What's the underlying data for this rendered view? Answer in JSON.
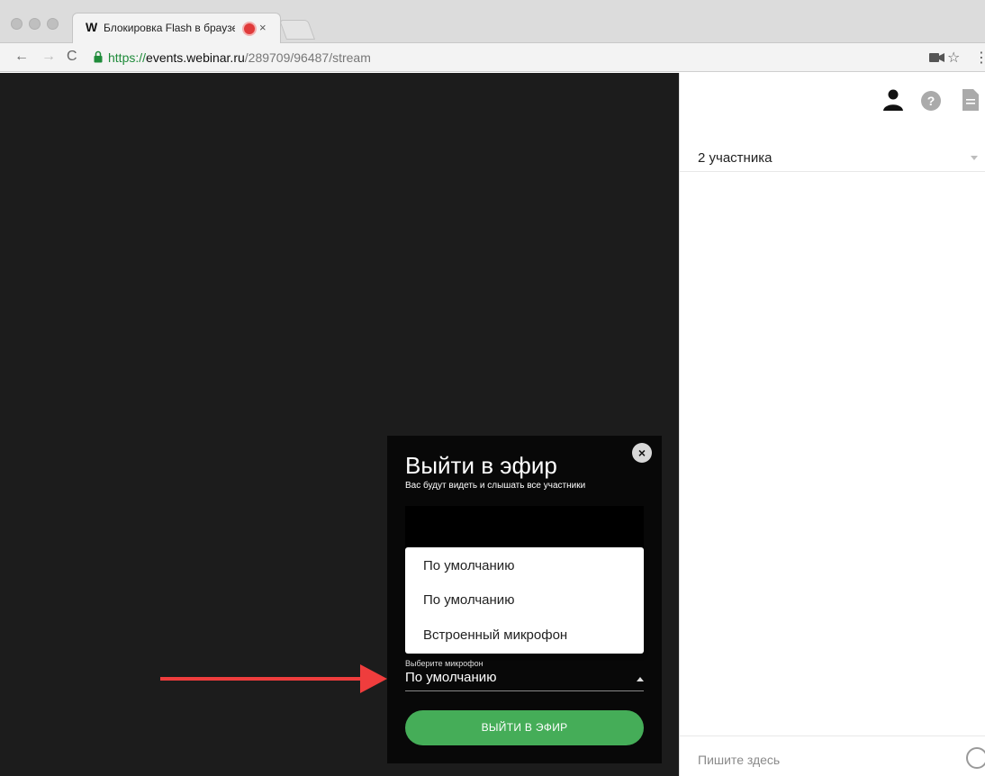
{
  "browser": {
    "tab_logo": "W",
    "tab_title": "Блокировка Flash в браузе",
    "tab_close": "×",
    "url_protocol": "https://",
    "url_host": "events.webinar.ru",
    "url_path": "/289709/96487/stream",
    "star": "☆",
    "menu": "⋮"
  },
  "sidebar": {
    "participants": "2 участника",
    "chat_placeholder": "Пишите здесь"
  },
  "modal": {
    "title": "Выйти в эфир",
    "subtitle": "Вас будут видеть и слышать все участники",
    "close": "×",
    "dropdown_options": [
      "По умолчанию",
      "По умолчанию",
      "Встроенный микрофон"
    ],
    "mic_label": "Выберите микрофон",
    "mic_value": "По умолчанию",
    "go_button": "ВЫЙТИ В ЭФИР"
  },
  "colors": {
    "accent_green": "#45ad58",
    "arrow_red": "#ef3d3d",
    "video_bg": "#1c1c1c"
  }
}
